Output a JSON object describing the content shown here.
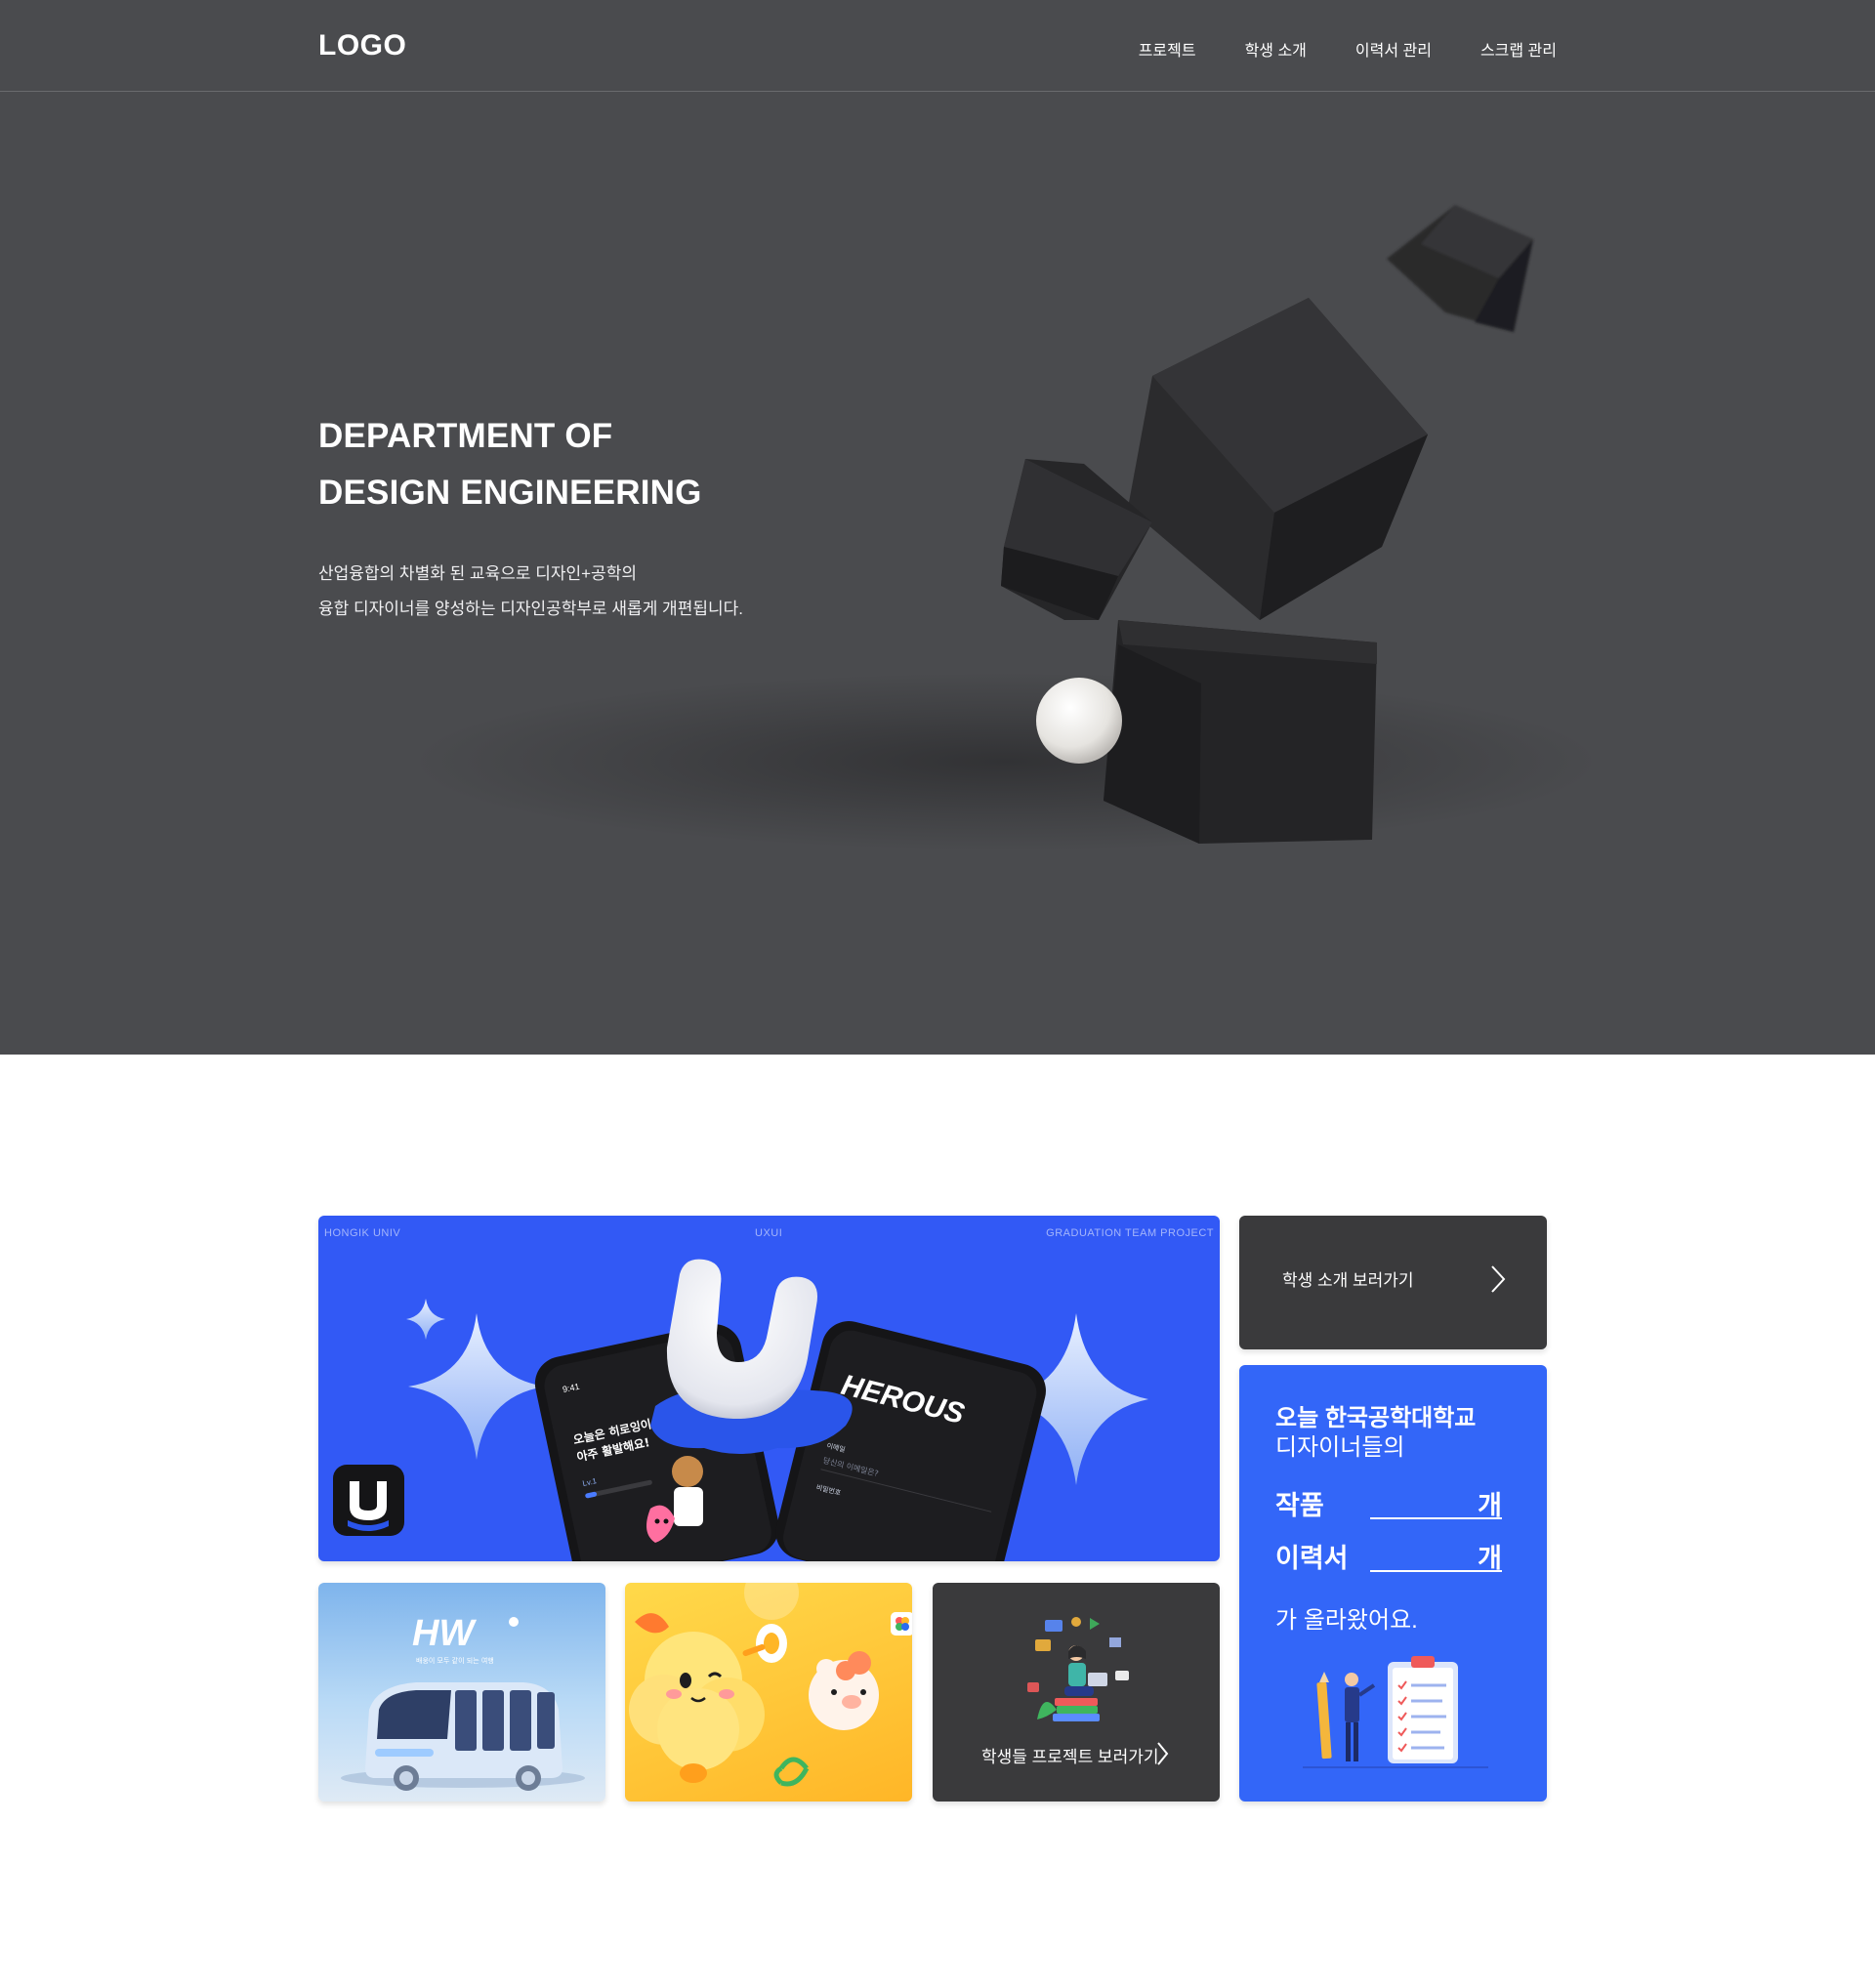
{
  "header": {
    "logo": "LOGO",
    "nav": [
      "프로젝트",
      "학생 소개",
      "이력서 관리",
      "스크랩 관리"
    ]
  },
  "hero": {
    "title_line1": "DEPARTMENT OF",
    "title_line2": "DESIGN ENGINEERING",
    "subtitle_line1": "산업융합의 차별화 된 교육으로 디자인+공학의",
    "subtitle_line2": "융합 디자이너를 양성하는 디자인공학부로 새롭게 개편됩니다."
  },
  "feature": {
    "caption_left": "HONGIK UNIV",
    "caption_center": "UXUI",
    "caption_right": "GRADUATION TEAM PROJECT",
    "phone_time": "9:41",
    "phone_text_line1": "오늘은 히로잉이",
    "phone_text_line2": "아주 활발해요!",
    "phone_level": "Lv.1",
    "brand_fragment": "HEROUS",
    "phone2_label1": "이메일",
    "phone2_hint1": "당신의 이메일은?",
    "phone2_label2": "비밀번호"
  },
  "students_button": {
    "label": "학생 소개 보러가기"
  },
  "stats": {
    "line1": "오늘 한국공학대학교",
    "line2": "디자이너들의",
    "works_label": "작품",
    "resumes_label": "이력서",
    "unit": "개",
    "line3": "가 올라왔어요."
  },
  "thumbs": {
    "hw_logo": "HW",
    "hw_caption": "배웅이 모두 같이 되는 여행",
    "projects_button_label": "학생들 프로젝트 보러가기"
  },
  "colors": {
    "hero_bg": "#4a4b4e",
    "accent_blue": "#3366f8",
    "dark_card": "#3a3a3c"
  }
}
